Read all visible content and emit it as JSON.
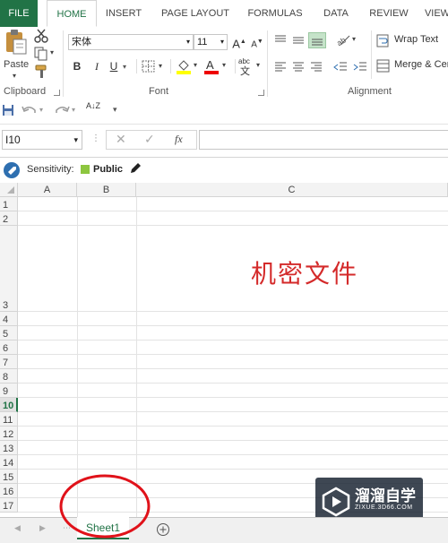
{
  "ribbon_tabs": [
    "FILE",
    "HOME",
    "INSERT",
    "PAGE LAYOUT",
    "FORMULAS",
    "DATA",
    "REVIEW",
    "VIEW"
  ],
  "active_tab": "HOME",
  "clipboard": {
    "paste_label": "Paste",
    "group_label": "Clipboard"
  },
  "font": {
    "name": "宋体",
    "size": "11",
    "group_label": "Font",
    "grow": "A",
    "shrink": "A",
    "bold": "B",
    "italic": "I",
    "underline": "U",
    "font_color": "A",
    "phonetic": "abc"
  },
  "alignment": {
    "wrap_text": "Wrap Text",
    "merge_center": "Merge & Cen",
    "group_label": "Alignment"
  },
  "qat": {
    "sort_label": "A↓Z"
  },
  "formula_bar": {
    "name_box": "I10",
    "fx": "fx",
    "formula": ""
  },
  "sensitivity": {
    "label": "Sensitivity:",
    "value": "Public",
    "public_color": "#8dc63f"
  },
  "columns": [
    "A",
    "B",
    "C"
  ],
  "rows": [
    "1",
    "2",
    "3",
    "4",
    "5",
    "6",
    "7",
    "8",
    "9",
    "10",
    "11",
    "12",
    "13",
    "14",
    "15",
    "16",
    "17"
  ],
  "selected_row": "10",
  "cell_text": {
    "value": "机密文件",
    "color": "#d42a2a"
  },
  "sheet_tabs": [
    "Sheet1"
  ],
  "watermark": {
    "title": "溜溜自学",
    "url": "ZIXUE.3D66.COM"
  },
  "accent_color": "#217346",
  "annotation_color": "#e0121a"
}
